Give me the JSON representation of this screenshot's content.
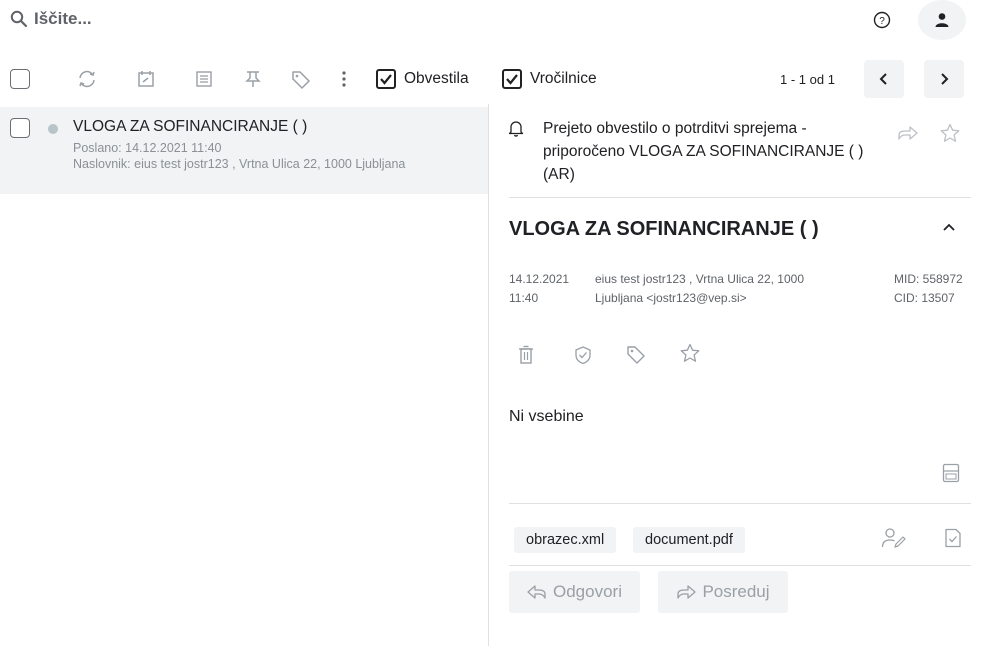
{
  "header": {
    "search_placeholder": "Iščite...",
    "icons": [
      "search-icon",
      "help-icon",
      "user-icon"
    ]
  },
  "toolbar": {
    "icons": [
      "select-all-checkbox",
      "refresh-icon",
      "calendar-icon",
      "list-icon",
      "pin-icon",
      "tag-icon",
      "more-vert-icon"
    ],
    "filters": [
      {
        "label": "Obvestila",
        "checked": true
      },
      {
        "label": "Vročilnice",
        "checked": true
      }
    ],
    "pagination": "1 - 1 od 1"
  },
  "list": {
    "items": [
      {
        "title": "VLOGA ZA SOFINANCIRANJE ( )",
        "sent": "Poslano: 14.12.2021 11:40",
        "recipient": "Naslovnik: eius test jostr123 , Vrtna Ulica 22, 1000 Ljubljana",
        "selected": true
      }
    ]
  },
  "detail": {
    "notification": "Prejeto obvestilo o potrditvi sprejema - priporočeno VLOGA ZA SOFINANCIRANJE ( ) (AR)",
    "title": "VLOGA ZA SOFINANCIRANJE ( )",
    "date": "14.12.2021",
    "time": "11:40",
    "sender_line1": "eius test jostr123 , Vrtna Ulica 22, 1000",
    "sender_line2": "Ljubljana <jostr123@vep.si>",
    "mid": "MID: 558972",
    "cid": "CID: 13507",
    "body": "Ni vsebine",
    "attachments": [
      "obrazec.xml",
      "document.pdf"
    ],
    "reply_label": "Odgovori",
    "forward_label": "Posreduj"
  }
}
